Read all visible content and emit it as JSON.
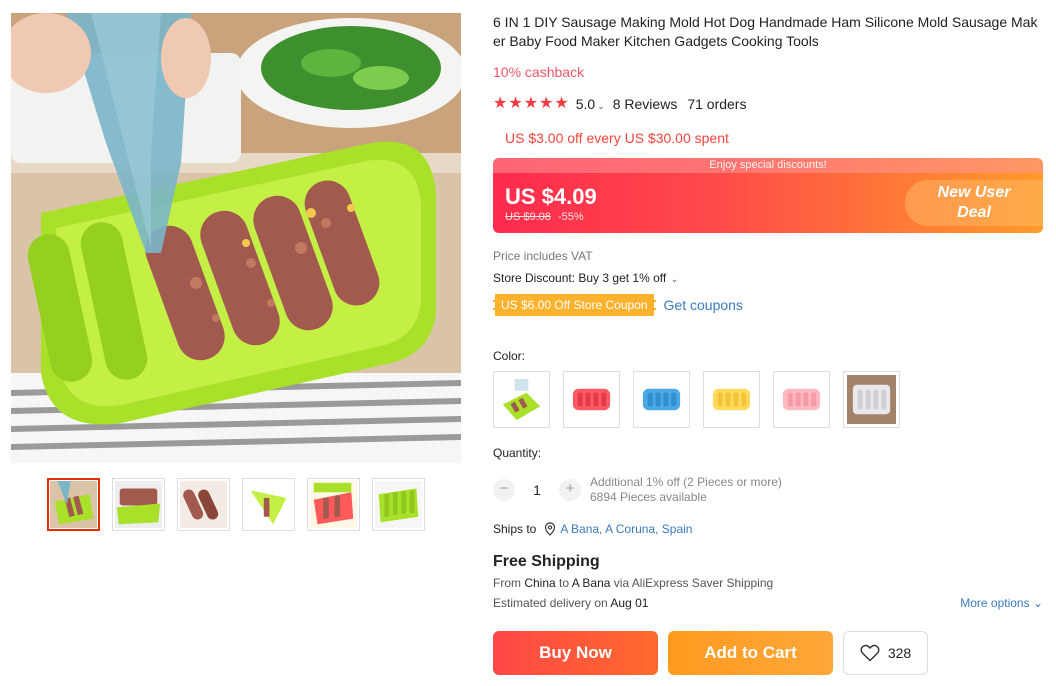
{
  "product": {
    "title": "6 IN 1 DIY Sausage Making Mold Hot Dog Handmade Ham Silicone Mold Sausage Maker Baby Food Maker Kitchen Gadgets Cooking Tools",
    "cashback": "10% cashback",
    "rating": "5.0",
    "rating_stars": 5,
    "reviews": "8 Reviews",
    "orders": "71 orders",
    "promo_line": "US $3.00 off every US $30.00 spent"
  },
  "price": {
    "banner_text": "Enjoy special discounts!",
    "current": "US $4.09",
    "original": "US $9.08",
    "discount": "-55%",
    "deal_line1": "New User",
    "deal_line2": "Deal",
    "vat_note": "Price includes VAT",
    "store_discount": "Store Discount: Buy 3 get 1% off",
    "coupon": "US $6.00 Off Store Coupon",
    "get_coupons": "Get coupons"
  },
  "variants": {
    "color_label": "Color:",
    "swatch_icons": [
      "green-mold-image",
      "red-mold-image",
      "blue-mold-image",
      "yellow-mold-image",
      "pink-mold-image",
      "white-mold-image"
    ]
  },
  "quantity": {
    "label": "Quantity:",
    "minus": "−",
    "plus": "+",
    "value": "1",
    "additional": "Additional 1% off (2 Pieces or more)",
    "available": "6894 Pieces available"
  },
  "shipping": {
    "ships_to_label": "Ships to",
    "location": "A Bana, A Coruna, Spain",
    "free_shipping": "Free Shipping",
    "from_prefix": "From",
    "origin": "China",
    "to_word": "to",
    "destination": "A Bana",
    "via_text": "via AliExpress Saver Shipping",
    "delivery_prefix": "Estimated delivery on",
    "delivery_date": "Aug 01",
    "more_options": "More options"
  },
  "actions": {
    "buy_now": "Buy Now",
    "add_to_cart": "Add to Cart",
    "wishlist_count": "328"
  },
  "colors": {
    "accent_red": "#f23c45",
    "link_blue": "#3a7bbf",
    "mold_green": "#a8e02a"
  }
}
